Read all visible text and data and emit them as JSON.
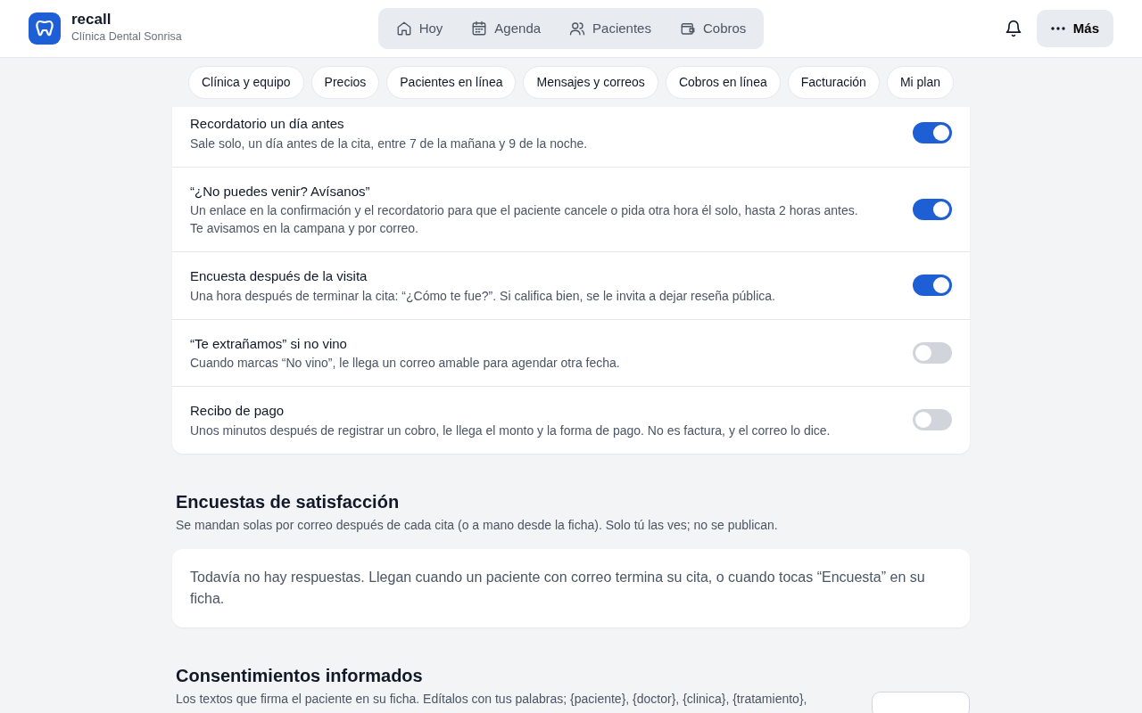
{
  "brand": {
    "name": "recall",
    "clinic": "Clínica Dental Sonrisa"
  },
  "nav": [
    {
      "label": "Hoy",
      "selected": false
    },
    {
      "label": "Agenda",
      "selected": false
    },
    {
      "label": "Pacientes",
      "selected": false
    },
    {
      "label": "Cobros",
      "selected": false
    }
  ],
  "more_button": "Más",
  "settings_tabs": [
    {
      "label": "Clínica y equipo"
    },
    {
      "label": "Precios"
    },
    {
      "label": "Pacientes en línea"
    },
    {
      "label": "Mensajes y correos"
    },
    {
      "label": "Cobros en línea"
    },
    {
      "label": "Facturación"
    },
    {
      "label": "Mi plan"
    }
  ],
  "notifications": [
    {
      "title": "Recordatorio un día antes",
      "description": [
        "Sale solo, un día antes de la cita, entre 7 de la mañana y 9 de la noche."
      ],
      "on": true
    },
    {
      "title": "“¿No puedes venir? Avísanos”",
      "description": [
        "Un enlace en la confirmación y el recordatorio para que el paciente cancele o pida otra hora él solo, hasta 2 horas antes.",
        "Te avisamos en la campana y por correo."
      ],
      "on": true
    },
    {
      "title": "Encuesta después de la visita",
      "description": [
        "Una hora después de terminar la cita: “¿Cómo te fue?”. Si califica bien, se le invita a dejar reseña pública."
      ],
      "on": true
    },
    {
      "title": "“Te extrañamos” si no vino",
      "description": [
        "Cuando marcas “No vino”, le llega un correo amable para agendar otra fecha."
      ],
      "on": false
    },
    {
      "title": "Recibo de pago",
      "description": [
        "Unos minutos después de registrar un cobro, le llega el monto y la forma de pago. No es factura, y el correo lo dice."
      ],
      "on": false
    }
  ],
  "surveys": {
    "title": "Encuestas de satisfacción",
    "subtitle": "Se mandan solas por correo después de cada cita (o a mano desde la ficha). Solo tú las ves; no se publican.",
    "empty_message": "Todavía no hay respuestas. Llegan cuando un paciente con correo termina su cita, o cuando tocas “Encuesta” en su ficha."
  },
  "consents": {
    "title": "Consentimientos informados",
    "subtitle": "Los textos que firma el paciente en su ficha. Edítalos con tus palabras; {paciente}, {doctor}, {clinica}, {tratamiento},"
  }
}
